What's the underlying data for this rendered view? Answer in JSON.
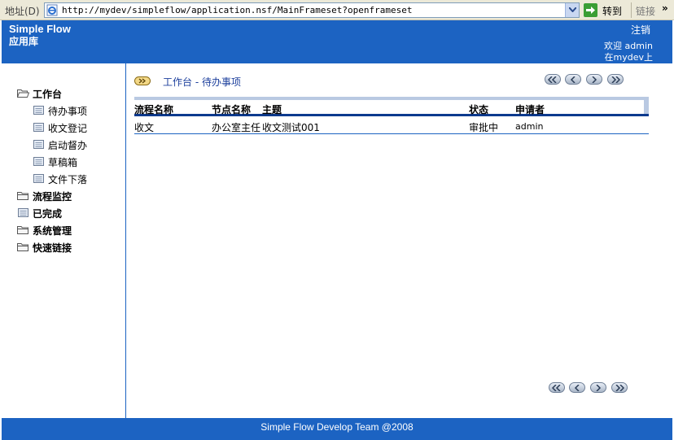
{
  "browser": {
    "address_label": "地址(D)",
    "url": "http://mydev/simpleflow/application.nsf/MainFrameset?openframeset",
    "go_label": "转到",
    "links_label": "链接",
    "chevron": "»"
  },
  "header": {
    "title": "Simple Flow",
    "subtitle": "应用库",
    "logout": "注销",
    "welcome": "欢迎 admin",
    "server": "在mydev上"
  },
  "nav": {
    "workbench": "工作台",
    "children": [
      "待办事项",
      "收文登记",
      "启动督办",
      "草稿箱",
      "文件下落"
    ],
    "process_monitor": "流程监控",
    "completed": "已完成",
    "system_admin": "系统管理",
    "quick_links": "快速链接"
  },
  "breadcrumb": {
    "root": "工作台",
    "separator": " - ",
    "current": "待办事项"
  },
  "table": {
    "columns": [
      "流程名称",
      "节点名称",
      "主题",
      "状态",
      "申请者"
    ],
    "rows": [
      [
        "收文",
        "办公室主任",
        "收文测试001",
        "审批中",
        "admin"
      ]
    ]
  },
  "footer": {
    "text": "Simple Flow Develop Team @2008"
  },
  "colors": {
    "brand_blue": "#1c63c2",
    "header_rule": "#0d3a8e",
    "toolbar": "#ece9d8"
  }
}
